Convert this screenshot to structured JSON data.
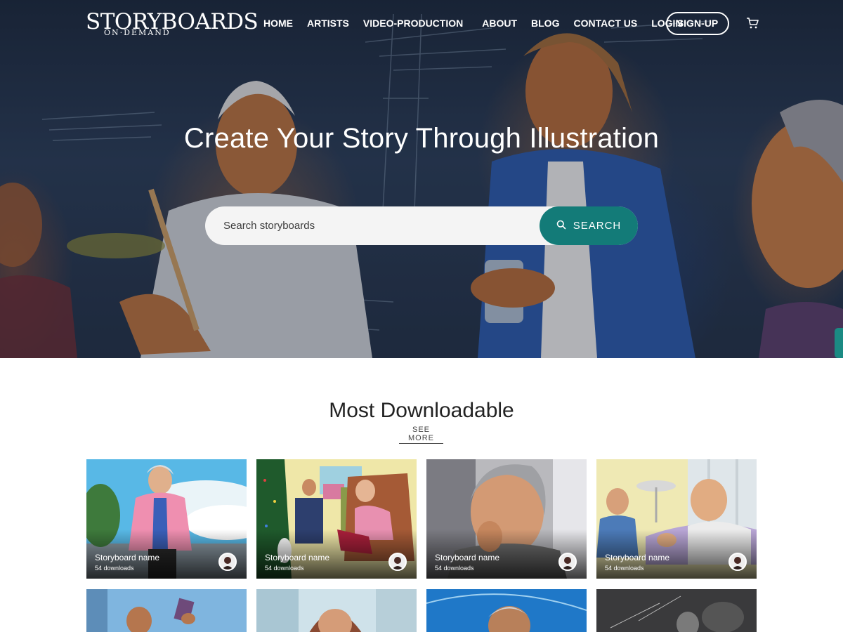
{
  "brand": {
    "top": "STORYBOARDS",
    "bottom": "ON·DEMAND"
  },
  "nav": {
    "items": [
      {
        "label": "HOME"
      },
      {
        "label": "ARTISTS"
      },
      {
        "label": "VIDEO-PRODUCTION"
      },
      {
        "label": "ABOUT"
      },
      {
        "label": "BLOG"
      },
      {
        "label": "CONTACT US"
      },
      {
        "label": "LOGIN"
      }
    ],
    "signup_label": "SIGN-UP",
    "cart_icon": "cart-icon"
  },
  "hero": {
    "title": "Create Your Story Through Illustration",
    "search": {
      "placeholder": "Search storyboards",
      "value": "",
      "button_label": "SEARCH",
      "icon": "search-icon"
    }
  },
  "colors": {
    "accent": "#137b78",
    "side_tab": "#1b8a83"
  },
  "section": {
    "title": "Most Downloadable",
    "see_more": "SEE MORE",
    "cards": [
      {
        "name": "Storyboard name",
        "downloads": "54 downloads"
      },
      {
        "name": "Storyboard name",
        "downloads": "54 downloads"
      },
      {
        "name": "Storyboard name",
        "downloads": "54 downloads"
      },
      {
        "name": "Storyboard name",
        "downloads": "54 downloads"
      }
    ]
  }
}
